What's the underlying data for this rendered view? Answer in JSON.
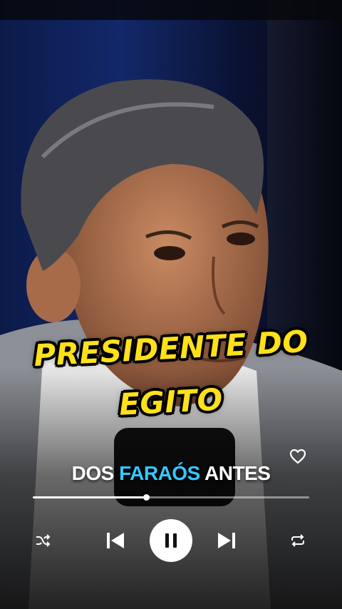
{
  "caption": {
    "line1": "PRESIDENTE DO",
    "line2": "EGITO"
  },
  "lyric": {
    "before": "DOS",
    "highlight": "FARAÓS",
    "after": "ANTES"
  },
  "player": {
    "progress": 0.41
  },
  "icons": {
    "like": "heart-outline-icon",
    "shuffle": "shuffle-icon",
    "previous": "skip-previous-icon",
    "pause": "pause-icon",
    "next": "skip-next-icon",
    "repeat": "repeat-icon"
  },
  "colors": {
    "caption": "#ffe11a",
    "lyric_highlight": "#35c8ff",
    "background": "#0b1a48"
  }
}
